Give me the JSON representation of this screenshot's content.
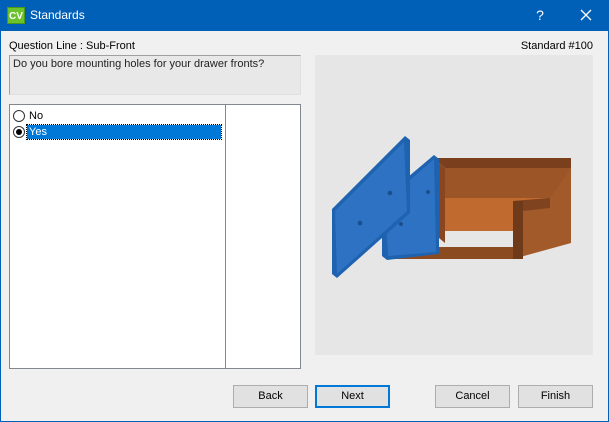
{
  "window": {
    "icon_text": "CV",
    "title": "Standards",
    "help_glyph": "?"
  },
  "header": {
    "question_line": "Question Line : Sub-Front",
    "standard": "Standard #100"
  },
  "question": {
    "text": "Do you bore mounting holes for your drawer fronts?"
  },
  "options": [
    {
      "label": "No",
      "checked": false
    },
    {
      "label": "Yes",
      "checked": true
    }
  ],
  "buttons": {
    "back": "Back",
    "next": "Next",
    "cancel": "Cancel",
    "finish": "Finish"
  },
  "colors": {
    "titlebar": "#0060b8",
    "selection": "#0078d7",
    "panel_blue": "#2e6fba",
    "drawer_brown": "#a35a2a"
  },
  "icons": [
    "app-logo-icon",
    "help-icon",
    "close-icon",
    "radio-icon"
  ]
}
